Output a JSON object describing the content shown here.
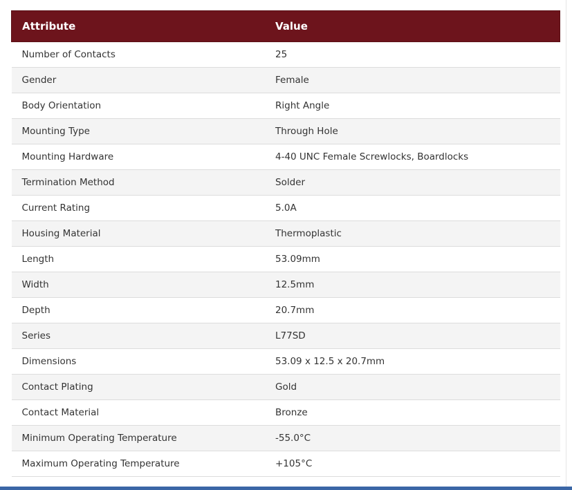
{
  "colors": {
    "header_background": "#6d141c",
    "header_text": "#ffffff",
    "row_alt_background": "#f4f4f4",
    "bottom_bar": "#3a66a6"
  },
  "table": {
    "headers": {
      "attribute": "Attribute",
      "value": "Value"
    },
    "rows": [
      {
        "attribute": "Number of Contacts",
        "value": "25"
      },
      {
        "attribute": "Gender",
        "value": "Female"
      },
      {
        "attribute": "Body Orientation",
        "value": "Right Angle"
      },
      {
        "attribute": "Mounting Type",
        "value": "Through Hole"
      },
      {
        "attribute": "Mounting Hardware",
        "value": "4-40 UNC Female Screwlocks, Boardlocks"
      },
      {
        "attribute": "Termination Method",
        "value": "Solder"
      },
      {
        "attribute": "Current Rating",
        "value": "5.0A"
      },
      {
        "attribute": "Housing Material",
        "value": "Thermoplastic"
      },
      {
        "attribute": "Length",
        "value": "53.09mm"
      },
      {
        "attribute": "Width",
        "value": "12.5mm"
      },
      {
        "attribute": "Depth",
        "value": "20.7mm"
      },
      {
        "attribute": "Series",
        "value": "L77SD"
      },
      {
        "attribute": "Dimensions",
        "value": "53.09 x 12.5 x 20.7mm"
      },
      {
        "attribute": "Contact Plating",
        "value": "Gold"
      },
      {
        "attribute": "Contact Material",
        "value": "Bronze"
      },
      {
        "attribute": "Minimum Operating Temperature",
        "value": "-55.0°C"
      },
      {
        "attribute": "Maximum Operating Temperature",
        "value": "+105°C"
      }
    ]
  }
}
